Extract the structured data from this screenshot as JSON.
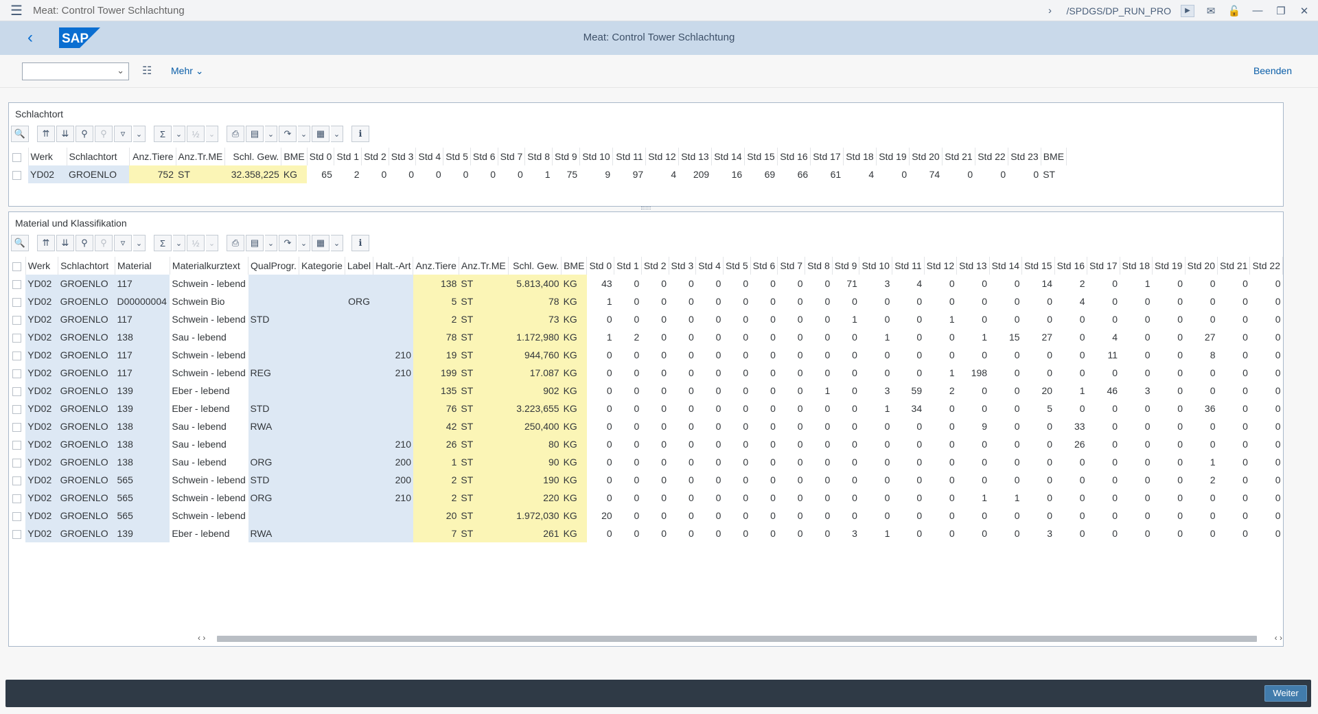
{
  "window": {
    "title": "Meat: Control Tower Schlachtung",
    "transaction": "/SPDGS/DP_RUN_PRO"
  },
  "shell": {
    "logo_text": "SAP",
    "title": "Meat: Control Tower Schlachtung",
    "brand_color": "#0a6ed1"
  },
  "toolbar": {
    "combo_value": "",
    "mehr_label": "Mehr",
    "beenden_label": "Beenden"
  },
  "panel1": {
    "title": "Schlachtort",
    "headers": [
      "Werk",
      "Schlachtort",
      "Anz.Tiere",
      "Anz.Tr.ME",
      "Schl. Gew.",
      "BME",
      "Std 0",
      "Std 1",
      "Std 2",
      "Std 3",
      "Std 4",
      "Std 5",
      "Std 6",
      "Std 7",
      "Std 8",
      "Std 9",
      "Std 10",
      "Std 11",
      "Std 12",
      "Std 13",
      "Std 14",
      "Std 15",
      "Std 16",
      "Std 17",
      "Std 18",
      "Std 19",
      "Std 20",
      "Std 21",
      "Std 22",
      "Std 23",
      "BME"
    ],
    "rows": [
      [
        "YD02",
        "GROENLO",
        "752",
        "ST",
        "32.358,225",
        "KG",
        "65",
        "2",
        "0",
        "0",
        "0",
        "0",
        "0",
        "0",
        "1",
        "75",
        "9",
        "97",
        "4",
        "209",
        "16",
        "69",
        "66",
        "61",
        "4",
        "0",
        "74",
        "0",
        "0",
        "0",
        "ST"
      ]
    ]
  },
  "panel2": {
    "title": "Material und Klassifikation",
    "headers": [
      "Werk",
      "Schlachtort",
      "Material",
      "Materialkurztext",
      "QualProgr.",
      "Kategorie",
      "Label",
      "Halt.-Art",
      "Anz.Tiere",
      "Anz.Tr.ME",
      "Schl. Gew.",
      "BME",
      "Std 0",
      "Std 1",
      "Std 2",
      "Std 3",
      "Std 4",
      "Std 5",
      "Std 6",
      "Std 7",
      "Std 8",
      "Std 9",
      "Std 10",
      "Std 11",
      "Std 12",
      "Std 13",
      "Std 14",
      "Std 15",
      "Std 16",
      "Std 17",
      "Std 18",
      "Std 19",
      "Std 20",
      "Std 21",
      "Std 22"
    ],
    "rows": [
      [
        "YD02",
        "GROENLO",
        "117",
        "Schwein - lebend",
        "",
        "",
        "",
        "",
        "138",
        "ST",
        "5.813,400",
        "KG",
        "43",
        "0",
        "0",
        "0",
        "0",
        "0",
        "0",
        "0",
        "0",
        "71",
        "3",
        "4",
        "0",
        "0",
        "0",
        "14",
        "2",
        "0",
        "1",
        "0",
        "0",
        "0",
        "0"
      ],
      [
        "YD02",
        "GROENLO",
        "D00000004",
        "Schwein Bio",
        "",
        "",
        "ORG",
        "",
        "5",
        "ST",
        "78",
        "KG",
        "1",
        "0",
        "0",
        "0",
        "0",
        "0",
        "0",
        "0",
        "0",
        "0",
        "0",
        "0",
        "0",
        "0",
        "0",
        "0",
        "4",
        "0",
        "0",
        "0",
        "0",
        "0",
        "0"
      ],
      [
        "YD02",
        "GROENLO",
        "117",
        "Schwein - lebend",
        "STD",
        "",
        "",
        "",
        "2",
        "ST",
        "73",
        "KG",
        "0",
        "0",
        "0",
        "0",
        "0",
        "0",
        "0",
        "0",
        "0",
        "1",
        "0",
        "0",
        "1",
        "0",
        "0",
        "0",
        "0",
        "0",
        "0",
        "0",
        "0",
        "0",
        "0"
      ],
      [
        "YD02",
        "GROENLO",
        "138",
        "Sau - lebend",
        "",
        "",
        "",
        "",
        "78",
        "ST",
        "1.172,980",
        "KG",
        "1",
        "2",
        "0",
        "0",
        "0",
        "0",
        "0",
        "0",
        "0",
        "0",
        "1",
        "0",
        "0",
        "1",
        "15",
        "27",
        "0",
        "4",
        "0",
        "0",
        "27",
        "0",
        "0"
      ],
      [
        "YD02",
        "GROENLO",
        "117",
        "Schwein - lebend",
        "",
        "",
        "",
        "210",
        "19",
        "ST",
        "944,760",
        "KG",
        "0",
        "0",
        "0",
        "0",
        "0",
        "0",
        "0",
        "0",
        "0",
        "0",
        "0",
        "0",
        "0",
        "0",
        "0",
        "0",
        "0",
        "11",
        "0",
        "0",
        "8",
        "0",
        "0"
      ],
      [
        "YD02",
        "GROENLO",
        "117",
        "Schwein - lebend",
        "REG",
        "",
        "",
        "210",
        "199",
        "ST",
        "17.087",
        "KG",
        "0",
        "0",
        "0",
        "0",
        "0",
        "0",
        "0",
        "0",
        "0",
        "0",
        "0",
        "0",
        "1",
        "198",
        "0",
        "0",
        "0",
        "0",
        "0",
        "0",
        "0",
        "0",
        "0"
      ],
      [
        "YD02",
        "GROENLO",
        "139",
        "Eber - lebend",
        "",
        "",
        "",
        "",
        "135",
        "ST",
        "902",
        "KG",
        "0",
        "0",
        "0",
        "0",
        "0",
        "0",
        "0",
        "0",
        "1",
        "0",
        "3",
        "59",
        "2",
        "0",
        "0",
        "20",
        "1",
        "46",
        "3",
        "0",
        "0",
        "0",
        "0"
      ],
      [
        "YD02",
        "GROENLO",
        "139",
        "Eber - lebend",
        "STD",
        "",
        "",
        "",
        "76",
        "ST",
        "3.223,655",
        "KG",
        "0",
        "0",
        "0",
        "0",
        "0",
        "0",
        "0",
        "0",
        "0",
        "0",
        "1",
        "34",
        "0",
        "0",
        "0",
        "5",
        "0",
        "0",
        "0",
        "0",
        "36",
        "0",
        "0"
      ],
      [
        "YD02",
        "GROENLO",
        "138",
        "Sau - lebend",
        "RWA",
        "",
        "",
        "",
        "42",
        "ST",
        "250,400",
        "KG",
        "0",
        "0",
        "0",
        "0",
        "0",
        "0",
        "0",
        "0",
        "0",
        "0",
        "0",
        "0",
        "0",
        "9",
        "0",
        "0",
        "33",
        "0",
        "0",
        "0",
        "0",
        "0",
        "0"
      ],
      [
        "YD02",
        "GROENLO",
        "138",
        "Sau - lebend",
        "",
        "",
        "",
        "210",
        "26",
        "ST",
        "80",
        "KG",
        "0",
        "0",
        "0",
        "0",
        "0",
        "0",
        "0",
        "0",
        "0",
        "0",
        "0",
        "0",
        "0",
        "0",
        "0",
        "0",
        "26",
        "0",
        "0",
        "0",
        "0",
        "0",
        "0"
      ],
      [
        "YD02",
        "GROENLO",
        "138",
        "Sau - lebend",
        "ORG",
        "",
        "",
        "200",
        "1",
        "ST",
        "90",
        "KG",
        "0",
        "0",
        "0",
        "0",
        "0",
        "0",
        "0",
        "0",
        "0",
        "0",
        "0",
        "0",
        "0",
        "0",
        "0",
        "0",
        "0",
        "0",
        "0",
        "0",
        "1",
        "0",
        "0"
      ],
      [
        "YD02",
        "GROENLO",
        "565",
        "Schwein - lebend",
        "STD",
        "",
        "",
        "200",
        "2",
        "ST",
        "190",
        "KG",
        "0",
        "0",
        "0",
        "0",
        "0",
        "0",
        "0",
        "0",
        "0",
        "0",
        "0",
        "0",
        "0",
        "0",
        "0",
        "0",
        "0",
        "0",
        "0",
        "0",
        "2",
        "0",
        "0"
      ],
      [
        "YD02",
        "GROENLO",
        "565",
        "Schwein - lebend",
        "ORG",
        "",
        "",
        "210",
        "2",
        "ST",
        "220",
        "KG",
        "0",
        "0",
        "0",
        "0",
        "0",
        "0",
        "0",
        "0",
        "0",
        "0",
        "0",
        "0",
        "0",
        "1",
        "1",
        "0",
        "0",
        "0",
        "0",
        "0",
        "0",
        "0",
        "0"
      ],
      [
        "YD02",
        "GROENLO",
        "565",
        "Schwein - lebend",
        "",
        "",
        "",
        "",
        "20",
        "ST",
        "1.972,030",
        "KG",
        "20",
        "0",
        "0",
        "0",
        "0",
        "0",
        "0",
        "0",
        "0",
        "0",
        "0",
        "0",
        "0",
        "0",
        "0",
        "0",
        "0",
        "0",
        "0",
        "0",
        "0",
        "0",
        "0"
      ],
      [
        "YD02",
        "GROENLO",
        "139",
        "Eber - lebend",
        "RWA",
        "",
        "",
        "",
        "7",
        "ST",
        "261",
        "KG",
        "0",
        "0",
        "0",
        "0",
        "0",
        "0",
        "0",
        "0",
        "0",
        "3",
        "1",
        "0",
        "0",
        "0",
        "0",
        "3",
        "0",
        "0",
        "0",
        "0",
        "0",
        "0",
        "0"
      ]
    ]
  },
  "footer": {
    "weiter_label": "Weiter"
  }
}
